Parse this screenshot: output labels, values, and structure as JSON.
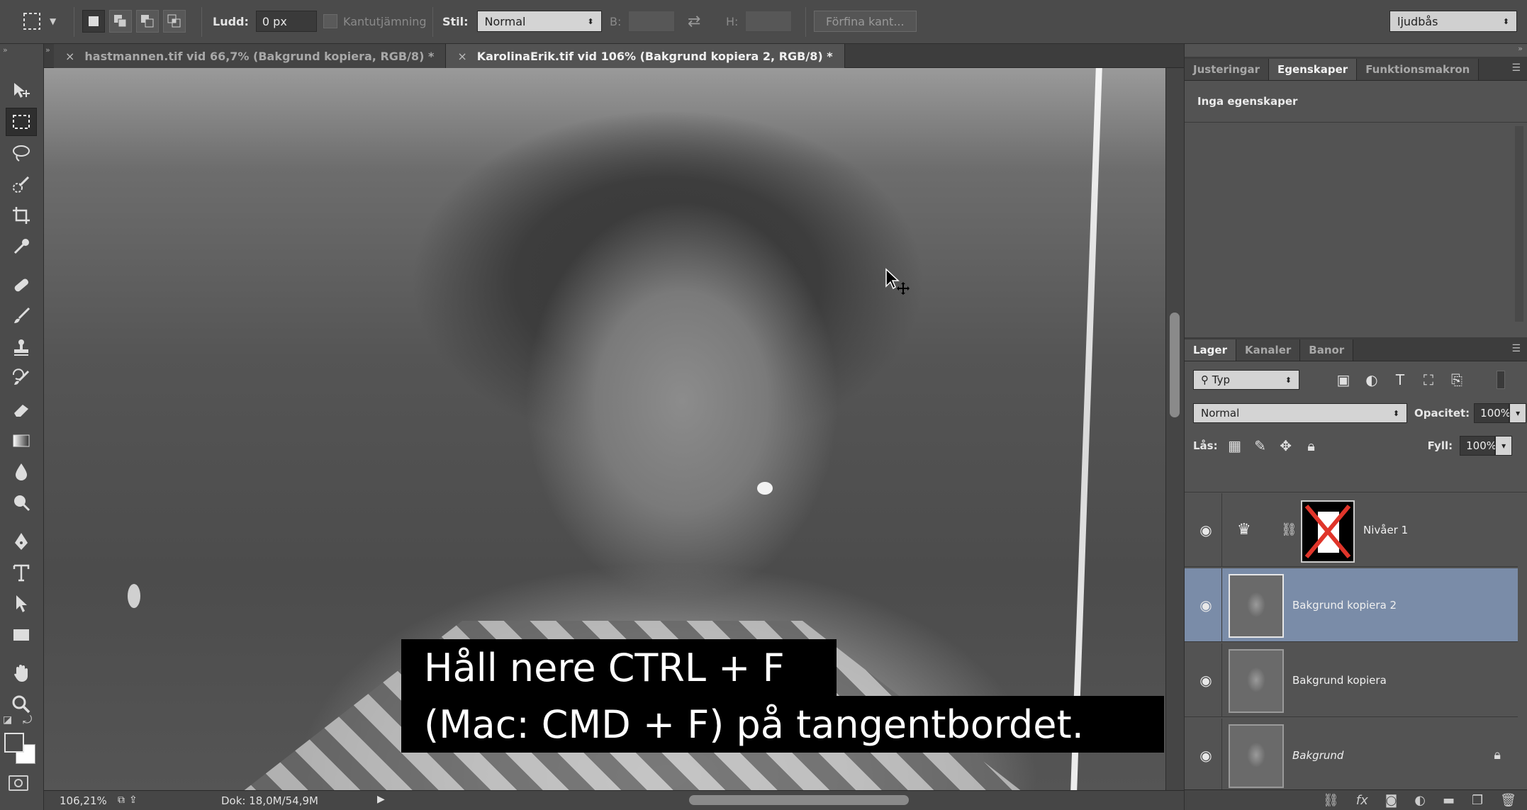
{
  "options_bar": {
    "feather_label": "Ludd:",
    "feather_value": "0 px",
    "antialias_label": "Kantutjämning",
    "style_label": "Stil:",
    "style_value": "Normal",
    "width_label": "B:",
    "height_label": "H:",
    "refine_edge_label": "Förfina kant...",
    "workspace_value": "ljudbås"
  },
  "tabs": [
    {
      "label": "hastmannen.tif vid 66,7% (Bakgrund kopiera, RGB/8) *"
    },
    {
      "label": "KarolinaErik.tif vid 106% (Bakgrund kopiera 2, RGB/8) *"
    }
  ],
  "subtitles": {
    "line1": "Håll nere CTRL + F",
    "line2": "(Mac: CMD + F) på tangentbordet."
  },
  "status": {
    "zoom": "106,21%",
    "doc": "Dok: 18,0M/54,9M"
  },
  "properties_panel": {
    "tabs": [
      "Justeringar",
      "Egenskaper",
      "Funktionsmakron"
    ],
    "empty_text": "Inga egenskaper"
  },
  "layers_panel": {
    "tabs": [
      "Lager",
      "Kanaler",
      "Banor"
    ],
    "filter_value": "Typ",
    "blend_mode": "Normal",
    "opacity_label": "Opacitet:",
    "opacity_value": "100%",
    "lock_label": "Lås:",
    "fill_label": "Fyll:",
    "fill_value": "100%",
    "layers": [
      {
        "name": "Nivåer 1"
      },
      {
        "name": "Bakgrund kopiera 2"
      },
      {
        "name": "Bakgrund kopiera"
      },
      {
        "name": "Bakgrund"
      }
    ]
  },
  "colors": {
    "selected_layer": "#7a8ca8",
    "panel_bg": "#535353"
  }
}
